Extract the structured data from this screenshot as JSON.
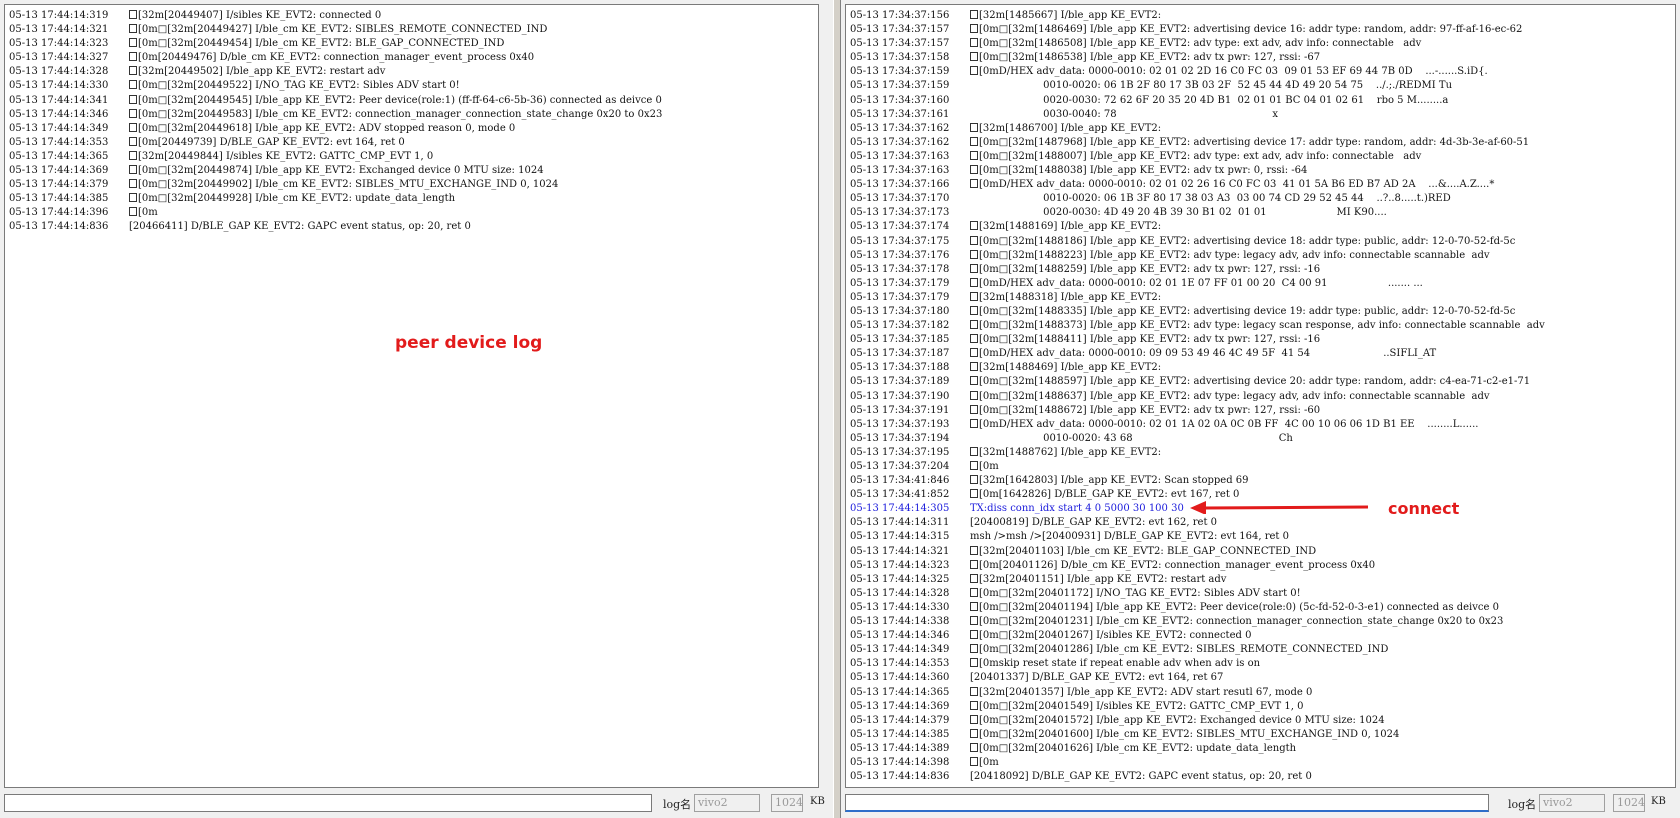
{
  "left": {
    "lines": [
      {
        "ts": "05-13 17:44:14:319",
        "box": true,
        "msg": "[32m[20449407] I/sibles KE_EVT2: connected 0"
      },
      {
        "ts": "05-13 17:44:14:321",
        "box": true,
        "msg": "[0m□[32m[20449427] I/ble_cm KE_EVT2: SIBLES_REMOTE_CONNECTED_IND"
      },
      {
        "ts": "05-13 17:44:14:323",
        "box": true,
        "msg": "[0m□[32m[20449454] I/ble_cm KE_EVT2: BLE_GAP_CONNECTED_IND"
      },
      {
        "ts": "05-13 17:44:14:327",
        "box": true,
        "msg": "[0m[20449476] D/ble_cm KE_EVT2: connection_manager_event_process 0x40"
      },
      {
        "ts": "05-13 17:44:14:328",
        "box": true,
        "msg": "[32m[20449502] I/ble_app KE_EVT2: restart adv"
      },
      {
        "ts": "05-13 17:44:14:330",
        "box": true,
        "msg": "[0m□[32m[20449522] I/NO_TAG KE_EVT2: Sibles ADV start 0!"
      },
      {
        "ts": "05-13 17:44:14:341",
        "box": true,
        "msg": "[0m□[32m[20449545] I/ble_app KE_EVT2: Peer device(role:1) (ff-ff-64-c6-5b-36) connected as deivce 0"
      },
      {
        "ts": "05-13 17:44:14:346",
        "box": true,
        "msg": "[0m□[32m[20449583] I/ble_cm KE_EVT2: connection_manager_connection_state_change 0x20 to 0x23"
      },
      {
        "ts": "05-13 17:44:14:349",
        "box": true,
        "msg": "[0m□[32m[20449618] I/ble_app KE_EVT2: ADV stopped reason 0, mode 0"
      },
      {
        "ts": "05-13 17:44:14:353",
        "box": true,
        "msg": "[0m[20449739] D/BLE_GAP KE_EVT2: evt 164, ret 0"
      },
      {
        "ts": "05-13 17:44:14:365",
        "box": true,
        "msg": "[32m[20449844] I/sibles KE_EVT2: GATTC_CMP_EVT 1, 0"
      },
      {
        "ts": "05-13 17:44:14:369",
        "box": true,
        "msg": "[0m□[32m[20449874] I/ble_app KE_EVT2: Exchanged device 0 MTU size: 1024"
      },
      {
        "ts": "05-13 17:44:14:379",
        "box": true,
        "msg": "[0m□[32m[20449902] I/ble_cm KE_EVT2: SIBLES_MTU_EXCHANGE_IND 0, 1024"
      },
      {
        "ts": "05-13 17:44:14:385",
        "box": true,
        "msg": "[0m□[32m[20449928] I/ble_cm KE_EVT2: update_data_length"
      },
      {
        "ts": "05-13 17:44:14:396",
        "box": true,
        "msg": "[0m"
      },
      {
        "ts": "05-13 17:44:14:836",
        "box": false,
        "msg": "[20466411] D/BLE_GAP KE_EVT2: GAPC event status, op: 20, ret 0"
      }
    ],
    "annotation": "peer device log",
    "cmd_value": "",
    "log_name_label": "log名",
    "log_name_value": "vivo2",
    "size_value": "1024",
    "size_unit": "KB"
  },
  "right": {
    "lines": [
      {
        "ts": "05-13 17:34:37:156",
        "box": true,
        "msg": "[32m[1485667] I/ble_app KE_EVT2:"
      },
      {
        "ts": "05-13 17:34:37:157",
        "box": true,
        "msg": "[0m□[32m[1486469] I/ble_app KE_EVT2: advertising device 16: addr type: random, addr: 97-ff-af-16-ec-62"
      },
      {
        "ts": "05-13 17:34:37:157",
        "box": true,
        "msg": "[0m□[32m[1486508] I/ble_app KE_EVT2: adv type: ext adv, adv info: connectable   adv"
      },
      {
        "ts": "05-13 17:34:37:158",
        "box": true,
        "msg": "[0m□[32m[1486538] I/ble_app KE_EVT2: adv tx pwr: 127, rssi: -67"
      },
      {
        "ts": "05-13 17:34:37:159",
        "box": true,
        "msg": "[0mD/HEX adv_data: 0000-0010: 02 01 02 2D 16 C0 FC 03  09 01 53 EF 69 44 7B 0D    ...-......S.iD{."
      },
      {
        "ts": "05-13 17:34:37:159",
        "box": false,
        "msg": "                       0010-0020: 06 1B 2F 80 17 3B 03 2F  52 45 44 4D 49 20 54 75    ../.;./REDMI Tu"
      },
      {
        "ts": "05-13 17:34:37:160",
        "box": false,
        "msg": "                       0020-0030: 72 62 6F 20 35 20 4D B1  02 01 01 BC 04 01 02 61    rbo 5 M........a"
      },
      {
        "ts": "05-13 17:34:37:161",
        "box": false,
        "msg": "                       0030-0040: 78                                                 x"
      },
      {
        "ts": "05-13 17:34:37:162",
        "box": true,
        "msg": "[32m[1486700] I/ble_app KE_EVT2:"
      },
      {
        "ts": "05-13 17:34:37:162",
        "box": true,
        "msg": "[0m□[32m[1487968] I/ble_app KE_EVT2: advertising device 17: addr type: random, addr: 4d-3b-3e-af-60-51"
      },
      {
        "ts": "05-13 17:34:37:163",
        "box": true,
        "msg": "[0m□[32m[1488007] I/ble_app KE_EVT2: adv type: ext adv, adv info: connectable   adv"
      },
      {
        "ts": "05-13 17:34:37:163",
        "box": true,
        "msg": "[0m□[32m[1488038] I/ble_app KE_EVT2: adv tx pwr: 0, rssi: -64"
      },
      {
        "ts": "05-13 17:34:37:166",
        "box": true,
        "msg": "[0mD/HEX adv_data: 0000-0010: 02 01 02 26 16 C0 FC 03  41 01 5A B6 ED B7 AD 2A    ...&....A.Z....*"
      },
      {
        "ts": "05-13 17:34:37:170",
        "box": false,
        "msg": "                       0010-0020: 06 1B 3F 80 17 38 03 A3  03 00 74 CD 29 52 45 44    ..?..8.....t.)RED"
      },
      {
        "ts": "05-13 17:34:37:173",
        "box": false,
        "msg": "                       0020-0030: 4D 49 20 4B 39 30 B1 02  01 01                      MI K90...."
      },
      {
        "ts": "05-13 17:34:37:174",
        "box": true,
        "msg": "[32m[1488169] I/ble_app KE_EVT2:"
      },
      {
        "ts": "05-13 17:34:37:175",
        "box": true,
        "msg": "[0m□[32m[1488186] I/ble_app KE_EVT2: advertising device 18: addr type: public, addr: 12-0-70-52-fd-5c"
      },
      {
        "ts": "05-13 17:34:37:176",
        "box": true,
        "msg": "[0m□[32m[1488223] I/ble_app KE_EVT2: adv type: legacy adv, adv info: connectable scannable  adv"
      },
      {
        "ts": "05-13 17:34:37:178",
        "box": true,
        "msg": "[0m□[32m[1488259] I/ble_app KE_EVT2: adv tx pwr: 127, rssi: -16"
      },
      {
        "ts": "05-13 17:34:37:179",
        "box": true,
        "msg": "[0mD/HEX adv_data: 0000-0010: 02 01 1E 07 FF 01 00 20  C4 00 91                   ....... ..."
      },
      {
        "ts": "05-13 17:34:37:179",
        "box": true,
        "msg": "[32m[1488318] I/ble_app KE_EVT2:"
      },
      {
        "ts": "05-13 17:34:37:180",
        "box": true,
        "msg": "[0m□[32m[1488335] I/ble_app KE_EVT2: advertising device 19: addr type: public, addr: 12-0-70-52-fd-5c"
      },
      {
        "ts": "05-13 17:34:37:182",
        "box": true,
        "msg": "[0m□[32m[1488373] I/ble_app KE_EVT2: adv type: legacy scan response, adv info: connectable scannable  adv"
      },
      {
        "ts": "05-13 17:34:37:185",
        "box": true,
        "msg": "[0m□[32m[1488411] I/ble_app KE_EVT2: adv tx pwr: 127, rssi: -16"
      },
      {
        "ts": "05-13 17:34:37:187",
        "box": true,
        "msg": "[0mD/HEX adv_data: 0000-0010: 09 09 53 49 46 4C 49 5F  41 54                       ..SIFLI_AT"
      },
      {
        "ts": "05-13 17:34:37:188",
        "box": true,
        "msg": "[32m[1488469] I/ble_app KE_EVT2:"
      },
      {
        "ts": "05-13 17:34:37:189",
        "box": true,
        "msg": "[0m□[32m[1488597] I/ble_app KE_EVT2: advertising device 20: addr type: random, addr: c4-ea-71-c2-e1-71"
      },
      {
        "ts": "05-13 17:34:37:190",
        "box": true,
        "msg": "[0m□[32m[1488637] I/ble_app KE_EVT2: adv type: legacy adv, adv info: connectable scannable  adv"
      },
      {
        "ts": "05-13 17:34:37:191",
        "box": true,
        "msg": "[0m□[32m[1488672] I/ble_app KE_EVT2: adv tx pwr: 127, rssi: -60"
      },
      {
        "ts": "05-13 17:34:37:193",
        "box": true,
        "msg": "[0mD/HEX adv_data: 0000-0010: 02 01 1A 02 0A 0C 0B FF  4C 00 10 06 06 1D B1 EE    ........L......"
      },
      {
        "ts": "05-13 17:34:37:194",
        "box": false,
        "msg": "                       0010-0020: 43 68                                              Ch"
      },
      {
        "ts": "05-13 17:34:37:195",
        "box": true,
        "msg": "[32m[1488762] I/ble_app KE_EVT2:"
      },
      {
        "ts": "05-13 17:34:37:204",
        "box": true,
        "msg": "[0m"
      },
      {
        "ts": "05-13 17:34:41:846",
        "box": true,
        "msg": "[32m[1642803] I/ble_app KE_EVT2: Scan stopped 69"
      },
      {
        "ts": "05-13 17:34:41:852",
        "box": true,
        "msg": "[0m[1642826] D/BLE_GAP KE_EVT2: evt 167, ret 0"
      },
      {
        "ts": "05-13 17:44:14:305",
        "box": false,
        "msg": "TX:diss conn_idx start 4 0 5000 30 100 30",
        "highlight": true
      },
      {
        "ts": "05-13 17:44:14:311",
        "box": false,
        "msg": "[20400819] D/BLE_GAP KE_EVT2: evt 162, ret 0"
      },
      {
        "ts": "05-13 17:44:14:315",
        "box": false,
        "msg": "msh />msh />[20400931] D/BLE_GAP KE_EVT2: evt 164, ret 0"
      },
      {
        "ts": "05-13 17:44:14:321",
        "box": true,
        "msg": "[32m[20401103] I/ble_cm KE_EVT2: BLE_GAP_CONNECTED_IND"
      },
      {
        "ts": "05-13 17:44:14:323",
        "box": true,
        "msg": "[0m[20401126] D/ble_cm KE_EVT2: connection_manager_event_process 0x40"
      },
      {
        "ts": "05-13 17:44:14:325",
        "box": true,
        "msg": "[32m[20401151] I/ble_app KE_EVT2: restart adv"
      },
      {
        "ts": "05-13 17:44:14:328",
        "box": true,
        "msg": "[0m□[32m[20401172] I/NO_TAG KE_EVT2: Sibles ADV start 0!"
      },
      {
        "ts": "05-13 17:44:14:330",
        "box": true,
        "msg": "[0m□[32m[20401194] I/ble_app KE_EVT2: Peer device(role:0) (5c-fd-52-0-3-e1) connected as deivce 0"
      },
      {
        "ts": "05-13 17:44:14:338",
        "box": true,
        "msg": "[0m□[32m[20401231] I/ble_cm KE_EVT2: connection_manager_connection_state_change 0x20 to 0x23"
      },
      {
        "ts": "05-13 17:44:14:346",
        "box": true,
        "msg": "[0m□[32m[20401267] I/sibles KE_EVT2: connected 0"
      },
      {
        "ts": "05-13 17:44:14:349",
        "box": true,
        "msg": "[0m□[32m[20401286] I/ble_cm KE_EVT2: SIBLES_REMOTE_CONNECTED_IND"
      },
      {
        "ts": "05-13 17:44:14:353",
        "box": true,
        "msg": "[0mskip reset state if repeat enable adv when adv is on"
      },
      {
        "ts": "05-13 17:44:14:360",
        "box": false,
        "msg": "[20401337] D/BLE_GAP KE_EVT2: evt 164, ret 67"
      },
      {
        "ts": "05-13 17:44:14:365",
        "box": true,
        "msg": "[32m[20401357] I/ble_app KE_EVT2: ADV start resutl 67, mode 0"
      },
      {
        "ts": "05-13 17:44:14:369",
        "box": true,
        "msg": "[0m□[32m[20401549] I/sibles KE_EVT2: GATTC_CMP_EVT 1, 0"
      },
      {
        "ts": "05-13 17:44:14:379",
        "box": true,
        "msg": "[0m□[32m[20401572] I/ble_app KE_EVT2: Exchanged device 0 MTU size: 1024"
      },
      {
        "ts": "05-13 17:44:14:385",
        "box": true,
        "msg": "[0m□[32m[20401600] I/ble_cm KE_EVT2: SIBLES_MTU_EXCHANGE_IND 0, 1024"
      },
      {
        "ts": "05-13 17:44:14:389",
        "box": true,
        "msg": "[0m□[32m[20401626] I/ble_cm KE_EVT2: update_data_length"
      },
      {
        "ts": "05-13 17:44:14:398",
        "box": true,
        "msg": "[0m"
      },
      {
        "ts": "05-13 17:44:14:836",
        "box": false,
        "msg": "[20418092] D/BLE_GAP KE_EVT2: GAPC event status, op: 20, ret 0"
      }
    ],
    "annotation": "connect",
    "cmd_value": "",
    "log_name_label": "log名",
    "log_name_value": "vivo2",
    "size_value": "1024",
    "size_unit": "KB"
  },
  "colors": {
    "annotation": "#e21b1b",
    "highlight_line": "#1a1adb",
    "input_focus": "#2d6ec9"
  }
}
